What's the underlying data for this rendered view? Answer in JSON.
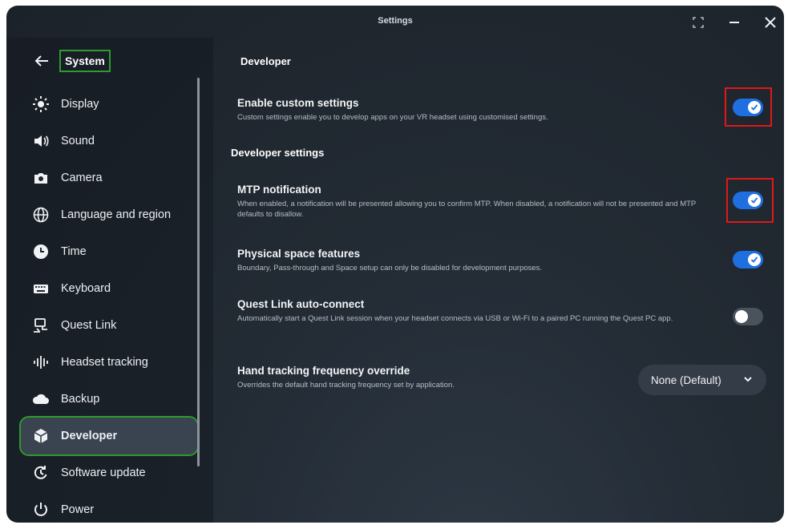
{
  "window": {
    "title": "Settings"
  },
  "sidebar": {
    "back_label": "System",
    "items": [
      {
        "label": "Display",
        "icon": "sun-icon"
      },
      {
        "label": "Sound",
        "icon": "speaker-icon"
      },
      {
        "label": "Camera",
        "icon": "camera-icon"
      },
      {
        "label": "Language and region",
        "icon": "globe-icon"
      },
      {
        "label": "Time",
        "icon": "clock-icon"
      },
      {
        "label": "Keyboard",
        "icon": "keyboard-icon"
      },
      {
        "label": "Quest Link",
        "icon": "link-cast-icon"
      },
      {
        "label": "Headset tracking",
        "icon": "tracking-wave-icon"
      },
      {
        "label": "Backup",
        "icon": "cloud-icon"
      },
      {
        "label": "Developer",
        "icon": "cube-icon",
        "active": true
      },
      {
        "label": "Software update",
        "icon": "update-icon"
      },
      {
        "label": "Power",
        "icon": "power-icon"
      }
    ]
  },
  "main": {
    "heading": "Developer",
    "subheading": "Developer settings",
    "settings": {
      "custom": {
        "title": "Enable custom settings",
        "desc": "Custom settings enable you to develop apps on your VR headset using customised settings.",
        "on": true
      },
      "mtp": {
        "title": "MTP notification",
        "desc": "When enabled, a notification will be presented allowing you to confirm MTP. When disabled, a notification will not be presented and MTP defaults to disallow.",
        "on": true
      },
      "physical": {
        "title": "Physical space features",
        "desc": "Boundary, Pass-through and Space setup can only be disabled for development purposes.",
        "on": true
      },
      "quest_link": {
        "title": "Quest Link auto-connect",
        "desc": "Automatically start a Quest Link session when your headset connects via USB or Wi-Fi to a paired PC running the Quest PC app.",
        "on": false
      },
      "hand_tracking": {
        "title": "Hand tracking frequency override",
        "desc": "Overrides the default hand tracking frequency set by application.",
        "value": "None (Default)"
      }
    }
  },
  "colors": {
    "accent": "#1f6fe0",
    "highlight_green": "#2f9a2f",
    "highlight_red": "#e01818"
  }
}
